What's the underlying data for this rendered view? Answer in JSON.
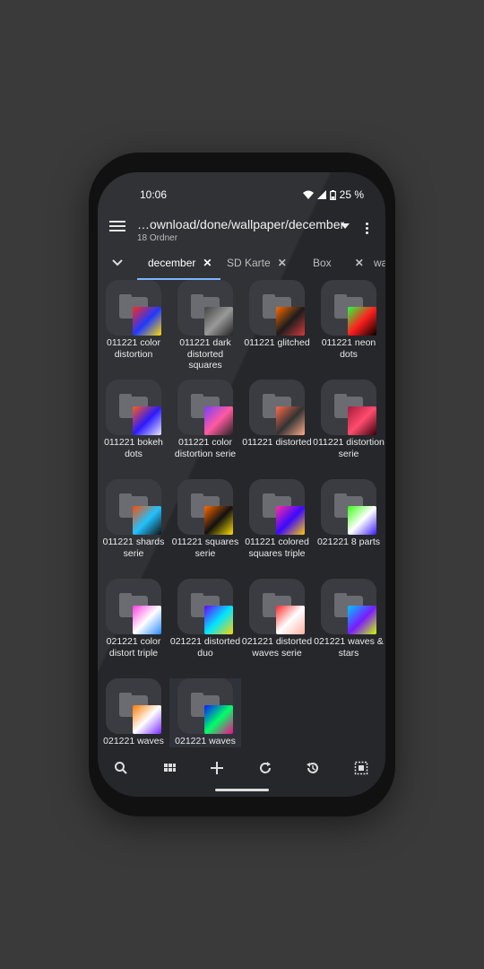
{
  "status": {
    "time": "10:06",
    "battery": "25 %"
  },
  "appbar": {
    "path": "…ownload/done/wallpaper/december",
    "subtitle": "18 Ordner"
  },
  "tabs": [
    {
      "label": "december"
    },
    {
      "label": "SD Karte"
    },
    {
      "label": "Box"
    },
    {
      "label": "wa"
    }
  ],
  "folders": [
    {
      "name": "011221 color distortion",
      "colors": [
        "#ff2a1a",
        "#1f39ff",
        "#ffdd00"
      ]
    },
    {
      "name": "011221 dark distorted squares",
      "colors": [
        "#444",
        "#999",
        "#222"
      ]
    },
    {
      "name": "011221 glitched",
      "colors": [
        "#ff6a00",
        "#1c1c1c",
        "#d63b3b"
      ]
    },
    {
      "name": "011221 neon dots",
      "colors": [
        "#27ff3a",
        "#ff1e1e",
        "#000"
      ]
    },
    {
      "name": "011221 bokeh dots",
      "colors": [
        "#ff5b1a",
        "#2b1aff",
        "#e7e7ff"
      ]
    },
    {
      "name": "011221 color distortion serie",
      "colors": [
        "#7a3cff",
        "#ff5aa0",
        "#222"
      ]
    },
    {
      "name": "011221 distorted",
      "colors": [
        "#ff6a4a",
        "#333",
        "#ffaa88"
      ]
    },
    {
      "name": "011221 distortion serie",
      "colors": [
        "#a51a3a",
        "#ff4c6e",
        "#330008"
      ]
    },
    {
      "name": "011221 shards serie",
      "colors": [
        "#ff4b00",
        "#21c2ff",
        "#111"
      ]
    },
    {
      "name": "011221 squares serie",
      "colors": [
        "#ff6a00",
        "#111",
        "#ffe000"
      ]
    },
    {
      "name": "011221 colored squares triple",
      "colors": [
        "#ff2aa0",
        "#3a0aff",
        "#ffcc00"
      ]
    },
    {
      "name": "021221 8 parts",
      "colors": [
        "#39ff14",
        "#ffffff",
        "#3a1aff"
      ]
    },
    {
      "name": "021221 color distort triple",
      "colors": [
        "#ff3de0",
        "#ffffff",
        "#2a8aff"
      ]
    },
    {
      "name": "021221 distorted duo",
      "colors": [
        "#6a00ff",
        "#00e5ff",
        "#ffd400"
      ]
    },
    {
      "name": "021221 distorted waves serie",
      "colors": [
        "#ff2a2a",
        "#ffffff",
        "#ffb0a0"
      ]
    },
    {
      "name": "021221 waves & stars",
      "colors": [
        "#00c8ff",
        "#7a1aff",
        "#c9ff00"
      ]
    },
    {
      "name": "021221 waves",
      "colors": [
        "#ff7a00",
        "#ffffff",
        "#7a2aff"
      ]
    },
    {
      "name": "021221 waves",
      "colors": [
        "#0a1aff",
        "#00ff66",
        "#ff0090"
      ]
    }
  ],
  "bottombar": [
    "search-icon",
    "grid-view-icon",
    "add-icon",
    "refresh-icon",
    "history-icon",
    "select-all-icon"
  ]
}
